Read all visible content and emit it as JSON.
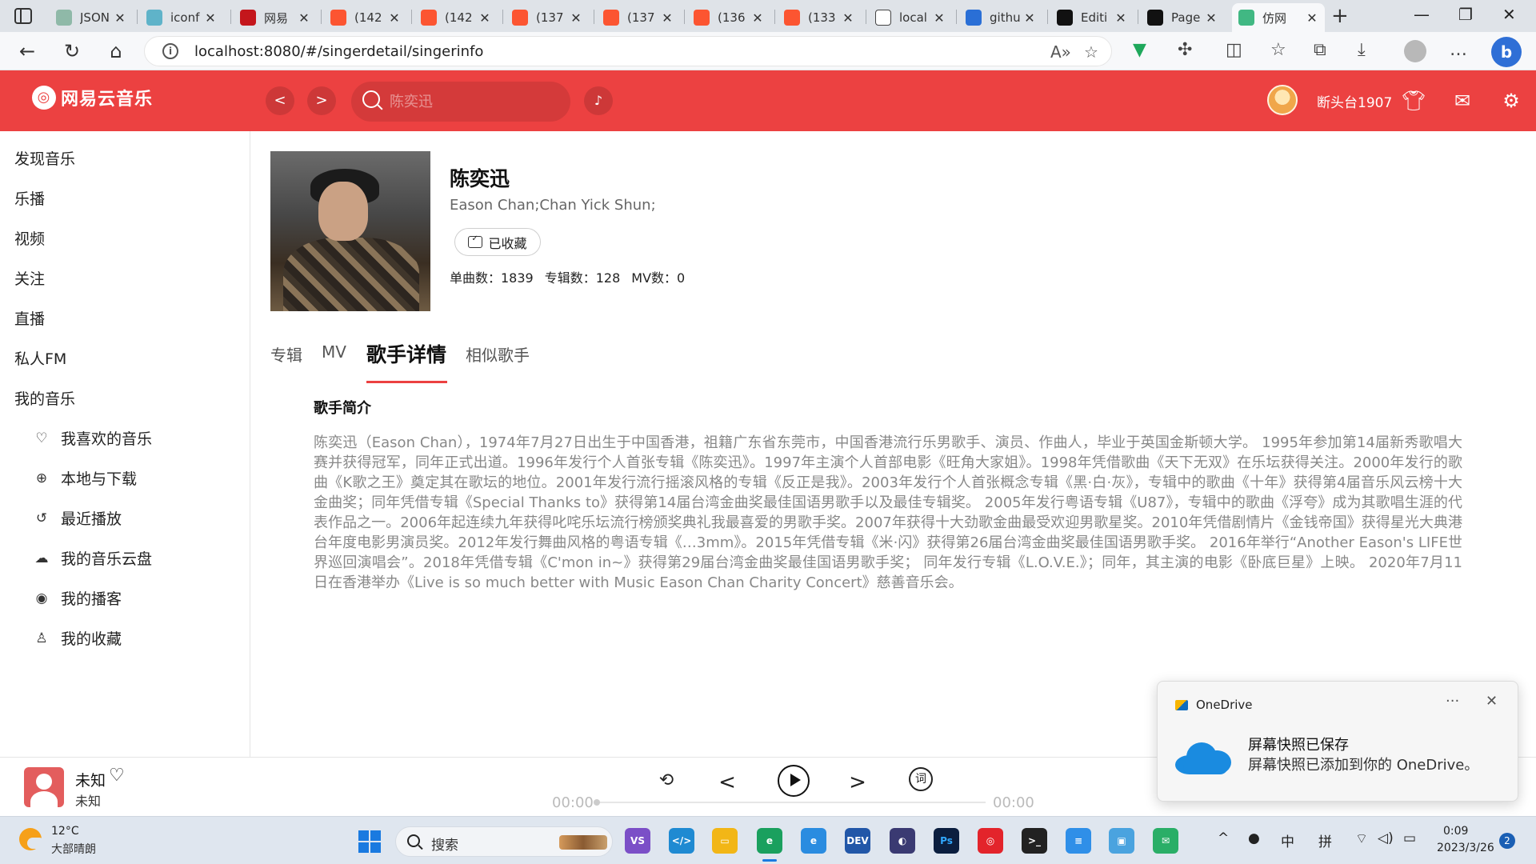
{
  "browser": {
    "tabs": [
      {
        "title": "JSON",
        "favicon": "gear-icon",
        "color": "#8fb9a8"
      },
      {
        "title": "iconf",
        "favicon": "gear-icon",
        "color": "#5fb3c9"
      },
      {
        "title": "网易",
        "favicon": "netease-icon",
        "color": "#c4161c"
      },
      {
        "title": "(142",
        "favicon": "csdn-icon",
        "color": "#fc5531"
      },
      {
        "title": "(142",
        "favicon": "csdn-icon",
        "color": "#fc5531"
      },
      {
        "title": "(137",
        "favicon": "csdn-icon",
        "color": "#fc5531"
      },
      {
        "title": "(137",
        "favicon": "csdn-icon",
        "color": "#fc5531"
      },
      {
        "title": "(136",
        "favicon": "csdn-icon",
        "color": "#fc5531"
      },
      {
        "title": "(133",
        "favicon": "csdn-icon",
        "color": "#fc5531"
      },
      {
        "title": "local",
        "favicon": "page-icon",
        "color": "#ffffff"
      },
      {
        "title": "githu",
        "favicon": "search-icon",
        "color": "#2a6fd6"
      },
      {
        "title": "Editi",
        "favicon": "github-icon",
        "color": "#111111"
      },
      {
        "title": "Page",
        "favicon": "github-icon",
        "color": "#111111"
      },
      {
        "title": "仿网",
        "favicon": "vue-icon",
        "color": "#41b883"
      }
    ],
    "url": "localhost:8080/#/singerdetail/singerinfo"
  },
  "app": {
    "logo_text": "网易云音乐",
    "search_placeholder": "陈奕迅",
    "username": "断头台1907",
    "accent_color": "#ec4141"
  },
  "sidebar": {
    "items": [
      "发现音乐",
      "乐播",
      "视频",
      "关注",
      "直播",
      "私人FM",
      "我的音乐"
    ],
    "my_music": [
      {
        "label": "我喜欢的音乐",
        "icon": "heart-icon"
      },
      {
        "label": "本地与下载",
        "icon": "download-icon"
      },
      {
        "label": "最近播放",
        "icon": "history-icon"
      },
      {
        "label": "我的音乐云盘",
        "icon": "cloud-icon"
      },
      {
        "label": "我的播客",
        "icon": "podcast-icon"
      },
      {
        "label": "我的收藏",
        "icon": "user-icon"
      }
    ]
  },
  "artist": {
    "name": "陈奕迅",
    "alias": "Eason Chan;Chan Yick Shun;",
    "fav_label": "已收藏",
    "singles_label": "单曲数：1839",
    "albums_label": "专辑数：128",
    "mv_label": "MV数：0"
  },
  "tabs": [
    "专辑",
    "MV",
    "歌手详情",
    "相似歌手"
  ],
  "bio": {
    "title": "歌手简介",
    "text": "陈奕迅（Eason Chan），1974年7月27日出生于中国香港，祖籍广东省东莞市，中国香港流行乐男歌手、演员、作曲人，毕业于英国金斯顿大学。 1995年参加第14届新秀歌唱大赛并获得冠军，同年正式出道。1996年发行个人首张专辑《陈奕迅》。1997年主演个人首部电影《旺角大家姐》。1998年凭借歌曲《天下无双》在乐坛获得关注。2000年发行的歌曲《K歌之王》奠定其在歌坛的地位。2001年发行流行摇滚风格的专辑《反正是我》。2003年发行个人首张概念专辑《黑·白·灰》，专辑中的歌曲《十年》获得第4届音乐风云榜十大金曲奖；同年凭借专辑《Special Thanks to》获得第14届台湾金曲奖最佳国语男歌手以及最佳专辑奖。 2005年发行粤语专辑《U87》，专辑中的歌曲《浮夸》成为其歌唱生涯的代表作品之一。2006年起连续九年获得叱咤乐坛流行榜颁奖典礼我最喜爱的男歌手奖。2007年获得十大劲歌金曲最受欢迎男歌星奖。2010年凭借剧情片《金钱帝国》获得星光大典港台年度电影男演员奖。2012年发行舞曲风格的粤语专辑《…3mm》。2015年凭借专辑《米·闪》获得第26届台湾金曲奖最佳国语男歌手奖。 2016年举行“Another Eason's LIFE世界巡回演唱会”。2018年凭借专辑《C'mon in~》获得第29届台湾金曲奖最佳国语男歌手奖； 同年发行专辑《L.O.V.E.》；同年，其主演的电影《卧底巨星》上映。 2020年7月11日在香港举办《Live is so much better with Music Eason Chan Charity Concert》慈善音乐会。"
  },
  "player": {
    "song_title": "未知",
    "song_artist": "未知",
    "time_current": "00:00",
    "time_total": "00:00",
    "progress": 0
  },
  "toast": {
    "app": "OneDrive",
    "title": "屏幕快照已保存",
    "body": "屏幕快照已添加到你的 OneDrive。"
  },
  "taskbar": {
    "temperature": "12°C",
    "weather": "大部晴朗",
    "search_label": "搜索",
    "ime_lang": "中",
    "ime_mode": "拼",
    "time": "0:09",
    "date": "2023/3/26",
    "notifications": "2"
  }
}
